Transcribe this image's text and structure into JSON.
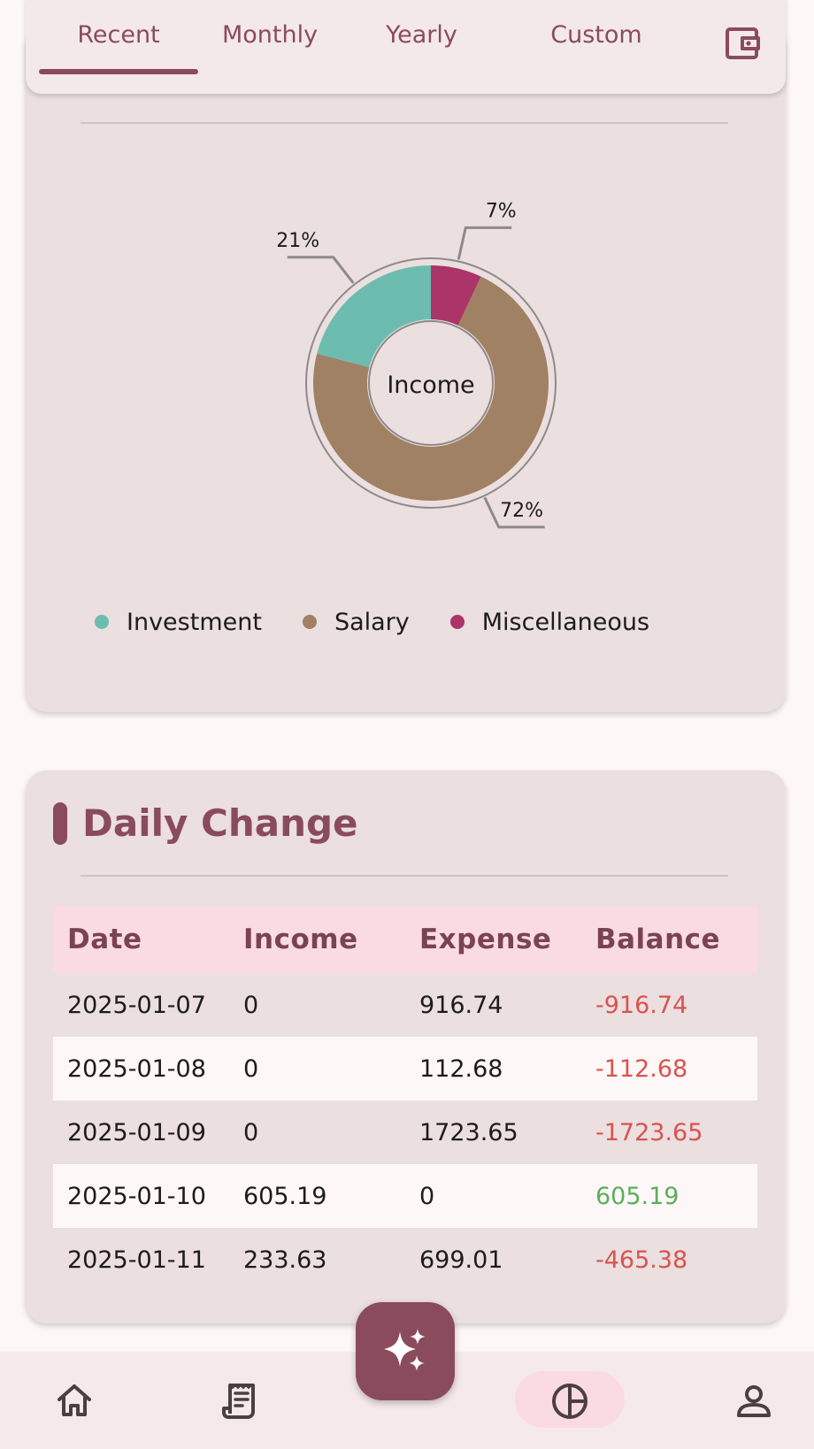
{
  "tabs": [
    {
      "label": "Recent",
      "active": true
    },
    {
      "label": "Monthly",
      "active": false
    },
    {
      "label": "Yearly",
      "active": false
    },
    {
      "label": "Custom",
      "active": false
    }
  ],
  "tab_bar_icon": "wallet-icon",
  "chart_data": {
    "type": "pie",
    "variant": "donut",
    "center_label": "Income",
    "categories": [
      "Investment",
      "Salary",
      "Miscellaneous"
    ],
    "values": [
      21,
      72,
      7
    ],
    "labels": [
      "21%",
      "72%",
      "7%"
    ],
    "colors": [
      "#6dbcb0",
      "#a08164",
      "#ab3468"
    ],
    "legend_position": "bottom"
  },
  "daily_change": {
    "title": "Daily Change",
    "columns": [
      "Date",
      "Income",
      "Expense",
      "Balance"
    ],
    "rows": [
      {
        "date": "2025-01-07",
        "income": "0",
        "expense": "916.74",
        "balance": "-916.74",
        "sign": "negative"
      },
      {
        "date": "2025-01-08",
        "income": "0",
        "expense": "112.68",
        "balance": "-112.68",
        "sign": "negative"
      },
      {
        "date": "2025-01-09",
        "income": "0",
        "expense": "1723.65",
        "balance": "-1723.65",
        "sign": "negative"
      },
      {
        "date": "2025-01-10",
        "income": "605.19",
        "expense": "0",
        "balance": "605.19",
        "sign": "positive"
      },
      {
        "date": "2025-01-11",
        "income": "233.63",
        "expense": "699.01",
        "balance": "-465.38",
        "sign": "negative"
      }
    ]
  },
  "fab": {
    "icon": "sparkles-icon"
  },
  "bottom_nav": [
    {
      "icon": "home-icon",
      "active": false
    },
    {
      "icon": "receipt-icon",
      "active": false
    },
    {
      "icon": "pie-chart-icon",
      "active": true
    },
    {
      "icon": "person-icon",
      "active": false
    }
  ],
  "colors": {
    "primary": "#8a4b5d",
    "card": "#ebdfe0",
    "background": "#fdf8f7",
    "negative": "#d9534f",
    "positive": "#5cad5c",
    "table_header": "#fadbe1"
  }
}
